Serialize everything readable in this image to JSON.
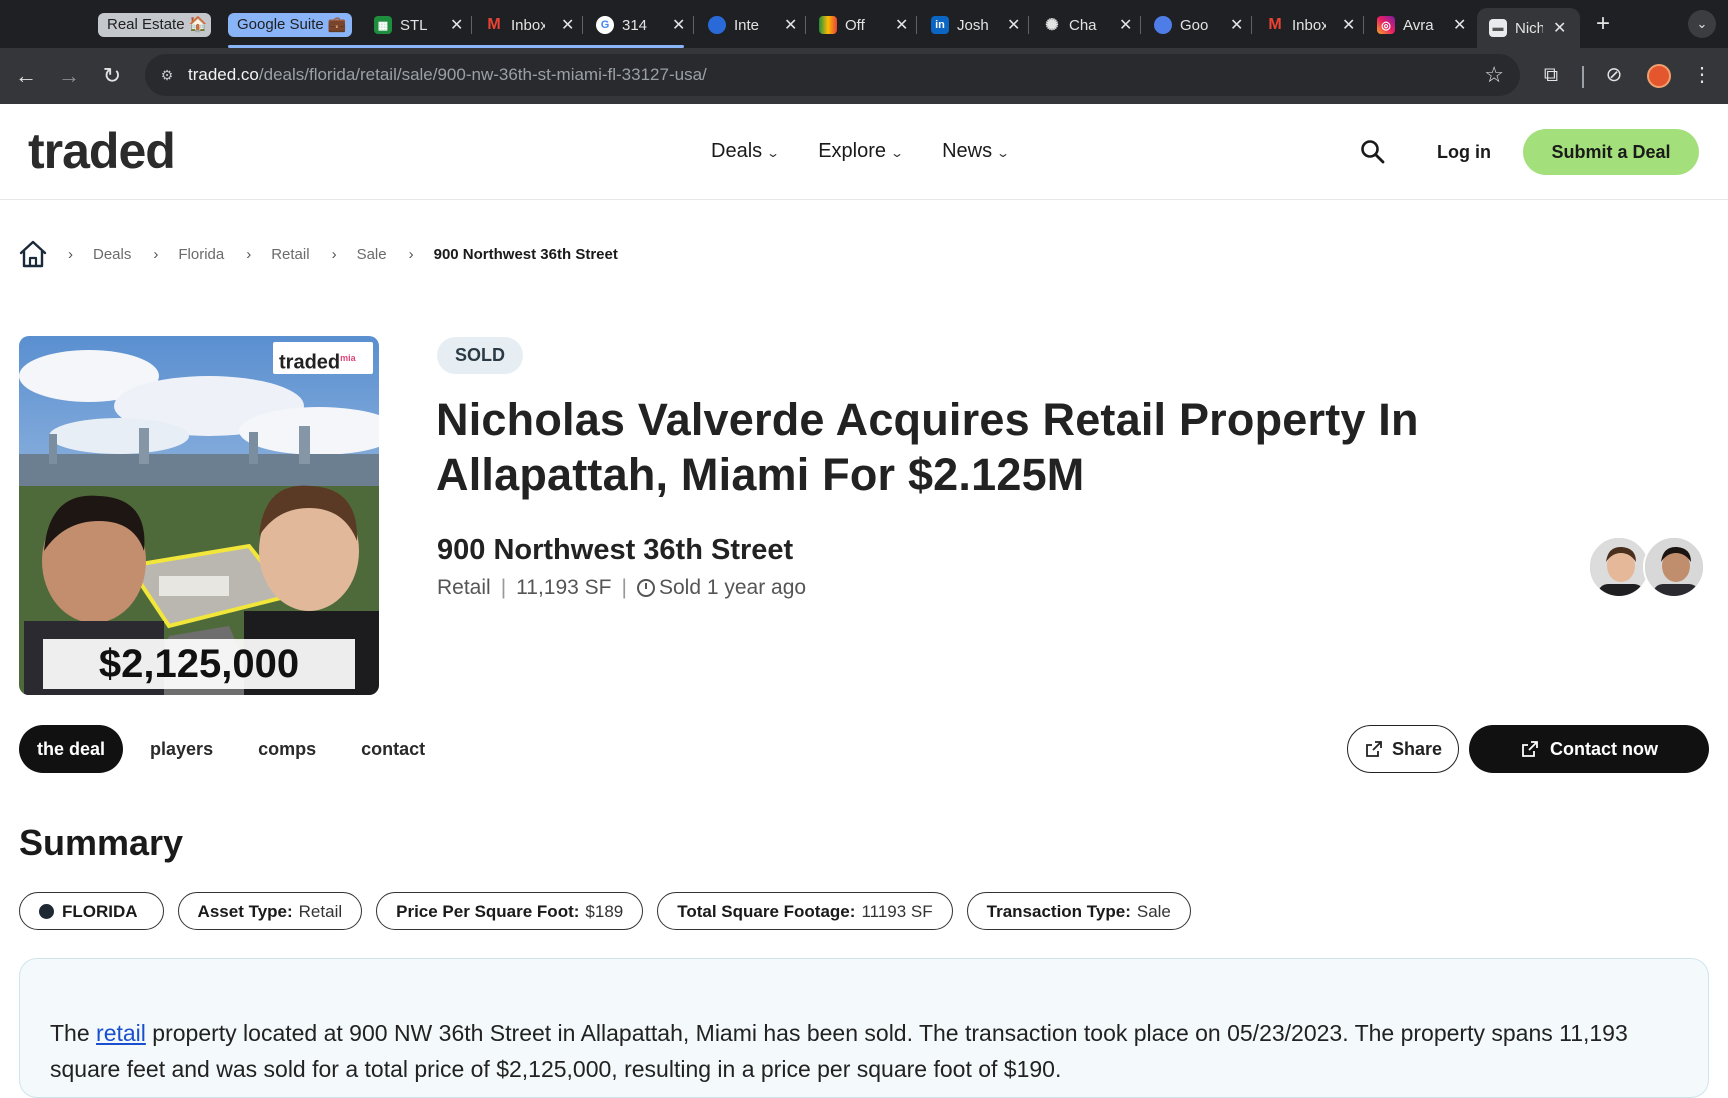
{
  "browser": {
    "tab_groups": [
      {
        "label": "Real Estate 🏠"
      },
      {
        "label": "Google Suite 💼"
      }
    ],
    "tabs": [
      {
        "title": "STL",
        "icon": "sheets-icon"
      },
      {
        "title": "Inbox",
        "icon": "gmail-icon"
      },
      {
        "title": "314",
        "icon": "google-icon"
      },
      {
        "title": "Inte",
        "icon": "globe-icon"
      },
      {
        "title": "Off",
        "icon": "drive-icon"
      },
      {
        "title": "Josh",
        "icon": "linkedin-icon"
      },
      {
        "title": "Cha",
        "icon": "chatgpt-icon"
      },
      {
        "title": "Goo",
        "icon": "gemini-icon"
      },
      {
        "title": "Inbox",
        "icon": "gmail-icon"
      },
      {
        "title": "Avra",
        "icon": "instagram-icon"
      },
      {
        "title": "Nich",
        "icon": "page-icon"
      }
    ],
    "url_host": "traded.co",
    "url_path": "/deals/florida/retail/sale/900-nw-36th-st-miami-fl-33127-usa/"
  },
  "header": {
    "logo": "traded",
    "nav": [
      {
        "label": "Deals"
      },
      {
        "label": "Explore"
      },
      {
        "label": "News"
      }
    ],
    "login_label": "Log in",
    "submit_label": "Submit a Deal"
  },
  "breadcrumb": {
    "items": [
      "Deals",
      "Florida",
      "Retail",
      "Sale"
    ],
    "current": "900 Northwest 36th Street"
  },
  "hero": {
    "image_brand": "traded",
    "image_brand_sup": "mia",
    "image_price": "$2,125,000",
    "status": "SOLD",
    "title": "Nicholas Valverde Acquires Retail Property In Allapattah, Miami For $2.125M",
    "property_name": "900 Northwest 36th Street",
    "asset": "Retail",
    "size": "11,193 SF",
    "sold_time": "Sold 1 year ago"
  },
  "deal_tabs": [
    {
      "label": "the deal"
    },
    {
      "label": "players"
    },
    {
      "label": "comps"
    },
    {
      "label": "contact"
    }
  ],
  "actions": {
    "share_label": "Share",
    "contact_label": "Contact now"
  },
  "summary": {
    "heading": "Summary",
    "state": "FLORIDA",
    "pills": [
      {
        "key": "Asset Type:",
        "value": "Retail"
      },
      {
        "key": "Price Per Square Foot:",
        "value": "$189"
      },
      {
        "key": "Total Square Footage:",
        "value": "11193 SF"
      },
      {
        "key": "Transaction Type:",
        "value": "Sale"
      }
    ],
    "text_before": "The ",
    "text_link": "retail",
    "text_after": " property located at 900 NW 36th Street in Allapattah, Miami has been sold. The transaction took place on 05/23/2023. The property spans 11,193 square feet and was sold for a total price of $2,125,000, resulting in a price per square foot of $190."
  },
  "colors": {
    "accent_green": "#a3e07c",
    "tab_group_blue": "#8ab4f8",
    "badge_bg": "#e6eef3",
    "summary_bg": "#f4f9fb"
  }
}
